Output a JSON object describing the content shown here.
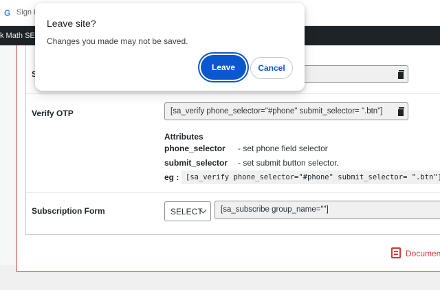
{
  "browser": {
    "google_glyph": "G",
    "signin_text": "Sign i",
    "adminbar_text": "k Math SEO"
  },
  "dialog": {
    "title": "Leave site?",
    "message": "Changes you made may not be saved.",
    "leave_label": "Leave",
    "cancel_label": "Cancel"
  },
  "settings": {
    "hidden_row_label": "S",
    "hidden_row_value": "",
    "verify_otp": {
      "label": "Verify OTP",
      "shortcode": "[sa_verify phone_selector=\"#phone\" submit_selector= \".btn\"]",
      "attributes_title": "Attributes",
      "attributes": [
        {
          "name": "phone_selector",
          "desc": "- set phone field selector"
        },
        {
          "name": "submit_selector",
          "desc": "- set submit button selector."
        }
      ],
      "eg_label": "eg :",
      "eg_code": "[sa_verify phone_selector=\"#phone\" submit_selector= \".btn\"]"
    },
    "subscription": {
      "label": "Subscription Form",
      "select_value": "SELECT",
      "shortcode": "[sa_subscribe group_name=\"\"]"
    }
  },
  "footer": {
    "doc_link": "Documen"
  },
  "icons": {
    "copy": "copy-icon",
    "doc": "document-icon",
    "chevron": "chevron-down-icon"
  },
  "colors": {
    "primary_button": "#0b57d0",
    "wp_admin_bar": "#1d2327",
    "accent_red": "#d63638"
  }
}
